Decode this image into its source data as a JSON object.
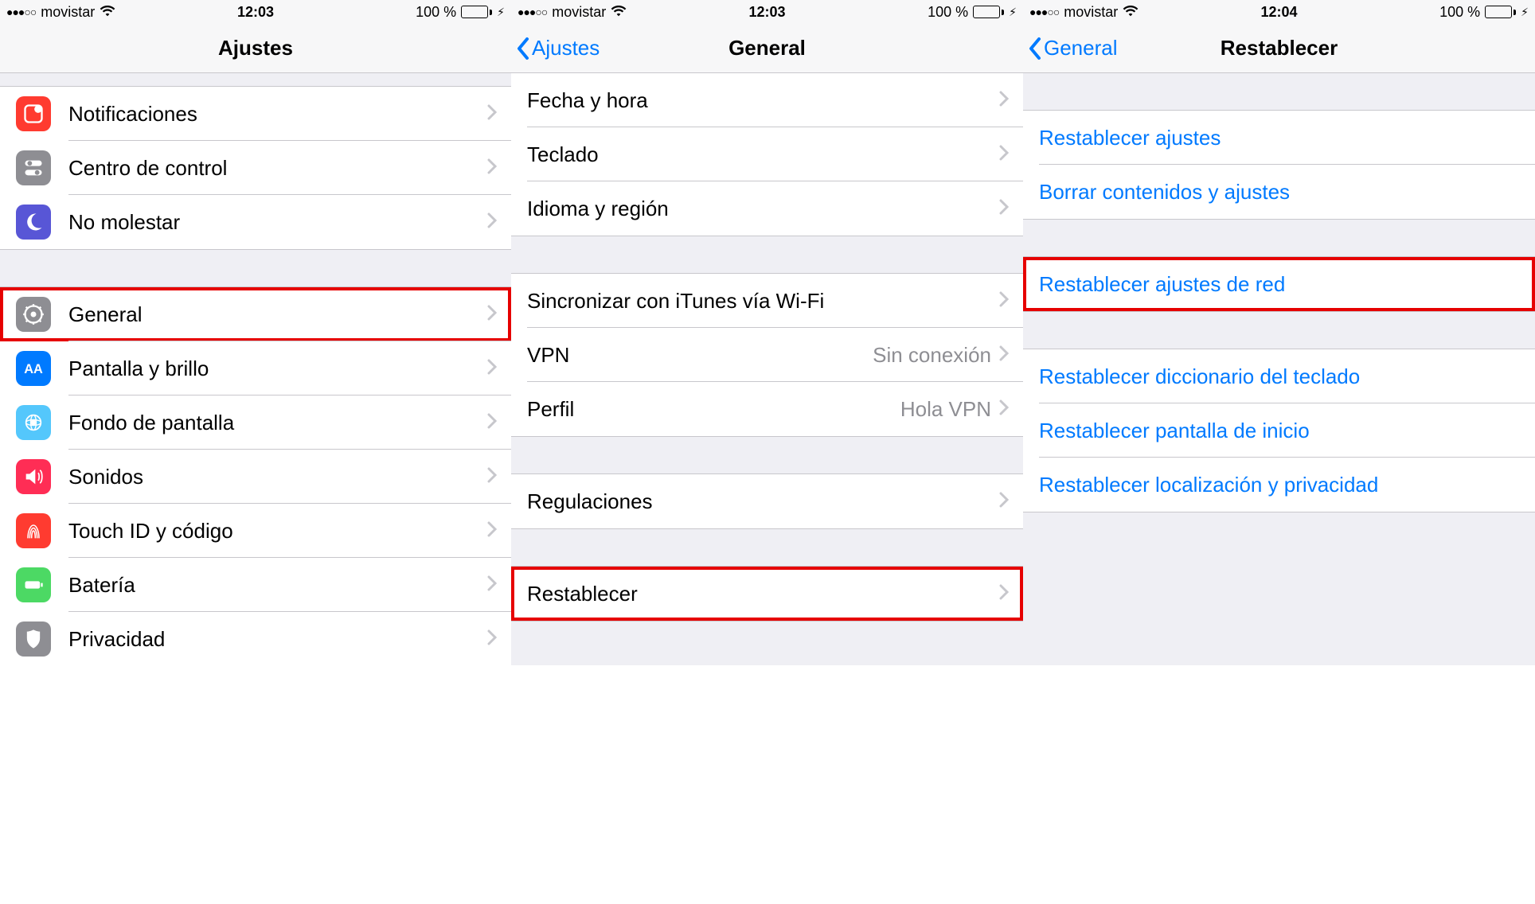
{
  "status": {
    "carrier": "movistar",
    "battery_text": "100 %",
    "dots": "●●●○○"
  },
  "screens": [
    {
      "time": "12:03",
      "title": "Ajustes",
      "back": null,
      "groups": [
        {
          "gap": "top"
        },
        {
          "cells": [
            {
              "icon": "notifications-icon",
              "bg": "bg-red",
              "label": "Notificaciones",
              "chevron": true
            },
            {
              "icon": "control-center-icon",
              "bg": "bg-gray",
              "label": "Centro de control",
              "chevron": true
            },
            {
              "icon": "moon-icon",
              "bg": "bg-purple",
              "label": "No molestar",
              "chevron": true
            }
          ]
        },
        {
          "gap": "normal"
        },
        {
          "cells": [
            {
              "icon": "gear-icon",
              "bg": "bg-gray",
              "label": "General",
              "chevron": true,
              "highlight": true
            },
            {
              "icon": "display-icon",
              "bg": "bg-blue",
              "label": "Pantalla y brillo",
              "chevron": true
            },
            {
              "icon": "wallpaper-icon",
              "bg": "bg-cyan",
              "label": "Fondo de pantalla",
              "chevron": true
            },
            {
              "icon": "sounds-icon",
              "bg": "bg-pink",
              "label": "Sonidos",
              "chevron": true
            },
            {
              "icon": "touchid-icon",
              "bg": "bg-redfp",
              "label": "Touch ID y código",
              "chevron": true
            },
            {
              "icon": "battery-icon",
              "bg": "bg-green",
              "label": "Batería",
              "chevron": true
            },
            {
              "icon": "privacy-icon",
              "bg": "bg-gray",
              "label": "Privacidad",
              "chevron": true
            }
          ]
        }
      ]
    },
    {
      "time": "12:03",
      "title": "General",
      "back": "Ajustes",
      "groups": [
        {
          "cells": [
            {
              "label": "Fecha y hora",
              "chevron": true
            },
            {
              "label": "Teclado",
              "chevron": true
            },
            {
              "label": "Idioma y región",
              "chevron": true
            }
          ]
        },
        {
          "gap": "normal"
        },
        {
          "cells": [
            {
              "label": "Sincronizar con iTunes vía Wi-Fi",
              "chevron": true
            },
            {
              "label": "VPN",
              "detail": "Sin conexión",
              "chevron": true
            },
            {
              "label": "Perfil",
              "detail": "Hola VPN",
              "chevron": true
            }
          ]
        },
        {
          "gap": "normal"
        },
        {
          "cells": [
            {
              "label": "Regulaciones",
              "chevron": true
            }
          ]
        },
        {
          "gap": "normal"
        },
        {
          "cells": [
            {
              "label": "Restablecer",
              "chevron": true,
              "highlight": true
            }
          ]
        }
      ]
    },
    {
      "time": "12:04",
      "title": "Restablecer",
      "back": "General",
      "groups": [
        {
          "gap": "normal"
        },
        {
          "cells": [
            {
              "label": "Restablecer ajustes",
              "blue": true
            },
            {
              "label": "Borrar contenidos y ajustes",
              "blue": true
            }
          ]
        },
        {
          "gap": "normal"
        },
        {
          "cells": [
            {
              "label": "Restablecer ajustes de red",
              "blue": true,
              "highlight": true
            }
          ]
        },
        {
          "gap": "normal"
        },
        {
          "cells": [
            {
              "label": "Restablecer diccionario del teclado",
              "blue": true
            },
            {
              "label": "Restablecer pantalla de inicio",
              "blue": true
            },
            {
              "label": "Restablecer localización y privacidad",
              "blue": true
            }
          ]
        }
      ]
    }
  ]
}
